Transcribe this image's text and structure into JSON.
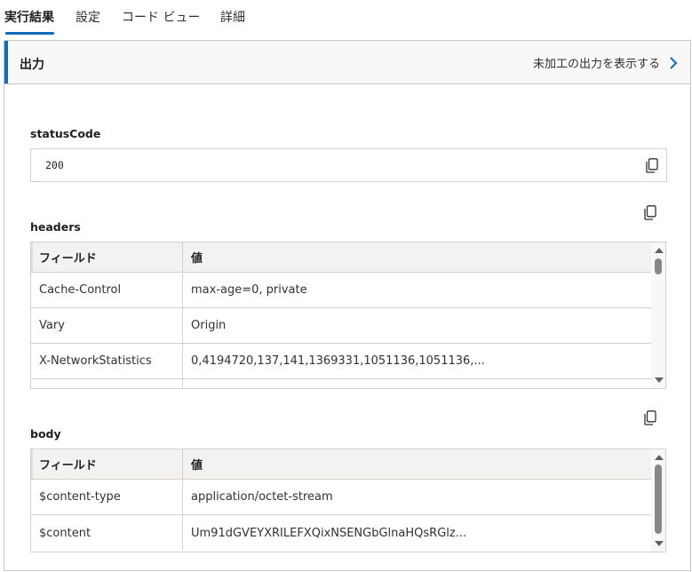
{
  "tabs": [
    {
      "label": "実行結果",
      "active": true
    },
    {
      "label": "設定",
      "active": false
    },
    {
      "label": "コード ビュー",
      "active": false
    },
    {
      "label": "詳細",
      "active": false
    }
  ],
  "output": {
    "title": "出力",
    "raw_link": "未加工の出力を表示する"
  },
  "status": {
    "label": "statusCode",
    "value": "200"
  },
  "headers": {
    "label": "headers",
    "columns": [
      "フィールド",
      "値"
    ],
    "rows": [
      {
        "field": "Cache-Control",
        "value": "max-age=0, private"
      },
      {
        "field": "Vary",
        "value": "Origin"
      },
      {
        "field": "X-NetworkStatistics",
        "value": "0,4194720,137,141,1369331,1051136,1051136,..."
      }
    ]
  },
  "body": {
    "label": "body",
    "columns": [
      "フィールド",
      "値"
    ],
    "rows": [
      {
        "field": "$content-type",
        "value": "application/octet-stream"
      },
      {
        "field": "$content",
        "value": "Um91dGVEYXRILEFXQixNSENGbGlnaHQsRGlz..."
      }
    ]
  },
  "colors": {
    "accent": "#0f6cbd",
    "border": "#d2d0ce",
    "header_bg": "#f3f2f1"
  },
  "icons": {
    "copy": "copy-icon",
    "chevron": "chevron-right-icon"
  }
}
